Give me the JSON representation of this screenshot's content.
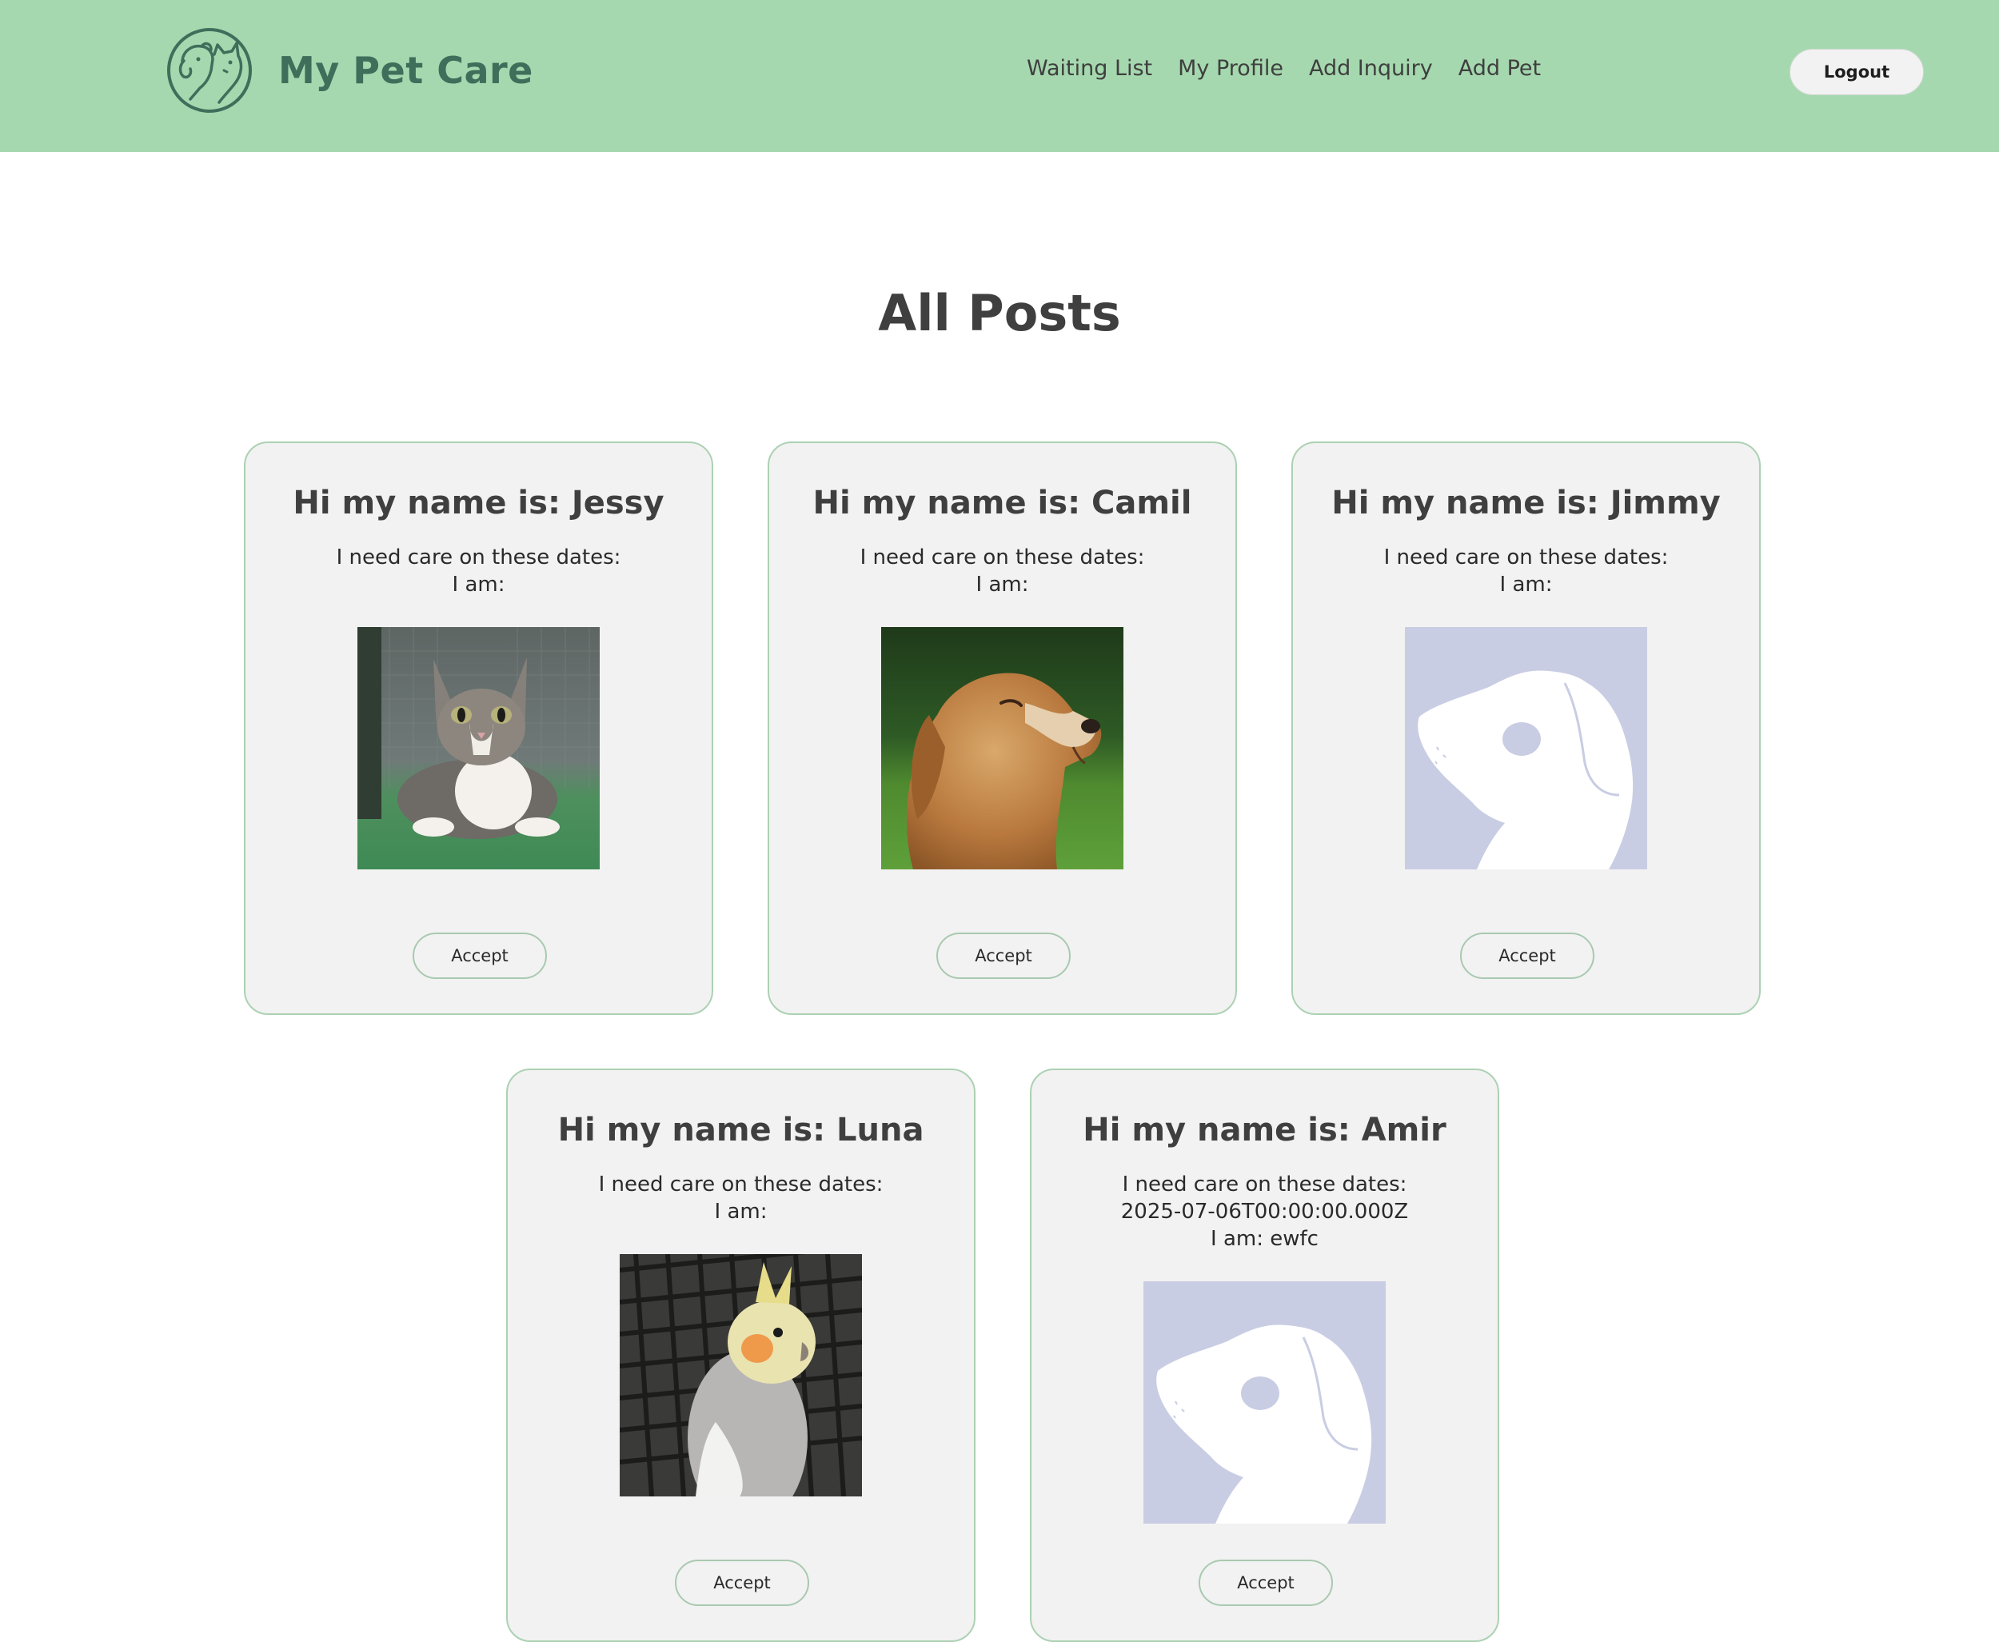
{
  "header": {
    "brand_name": "My Pet Care",
    "logo_icon": "cat-and-dog-logo-icon",
    "nav": [
      {
        "label": "Waiting List"
      },
      {
        "label": "My Profile"
      },
      {
        "label": "Add Inquiry"
      },
      {
        "label": "Add Pet"
      }
    ],
    "logout_label": "Logout"
  },
  "main": {
    "title": "All Posts",
    "posts": [
      {
        "heading": "Hi my name is: Jessy",
        "dates_label": "I need care on these dates:",
        "dates": "",
        "am_label": "I am:",
        "photo": "tabby-kitten-photo",
        "accept_label": "Accept"
      },
      {
        "heading": "Hi my name is: Camil",
        "dates_label": "I need care on these dates:",
        "dates": "",
        "am_label": "I am:",
        "photo": "golden-retriever-photo",
        "accept_label": "Accept"
      },
      {
        "heading": "Hi my name is: Jimmy",
        "dates_label": "I need care on these dates:",
        "dates": "",
        "am_label": "I am:",
        "photo": "dog-placeholder-image",
        "accept_label": "Accept"
      },
      {
        "heading": "Hi my name is: Luna",
        "dates_label": "I need care on these dates:",
        "dates": "",
        "am_label": "I am:",
        "photo": "cockatiel-photo",
        "accept_label": "Accept"
      },
      {
        "heading": "Hi my name is: Amir",
        "dates_label": "I need care on these dates:",
        "dates": "2025-07-06T00:00:00.000Z",
        "am_label": "I am: ewfc",
        "photo": "dog-placeholder-image",
        "accept_label": "Accept"
      }
    ]
  },
  "colors": {
    "header_bg": "#a5d8ae",
    "brand_text": "#3f6e5b",
    "card_bg": "#f2f2f2",
    "card_border": "#acd1b3",
    "placeholder_bg": "#c9cde3"
  }
}
